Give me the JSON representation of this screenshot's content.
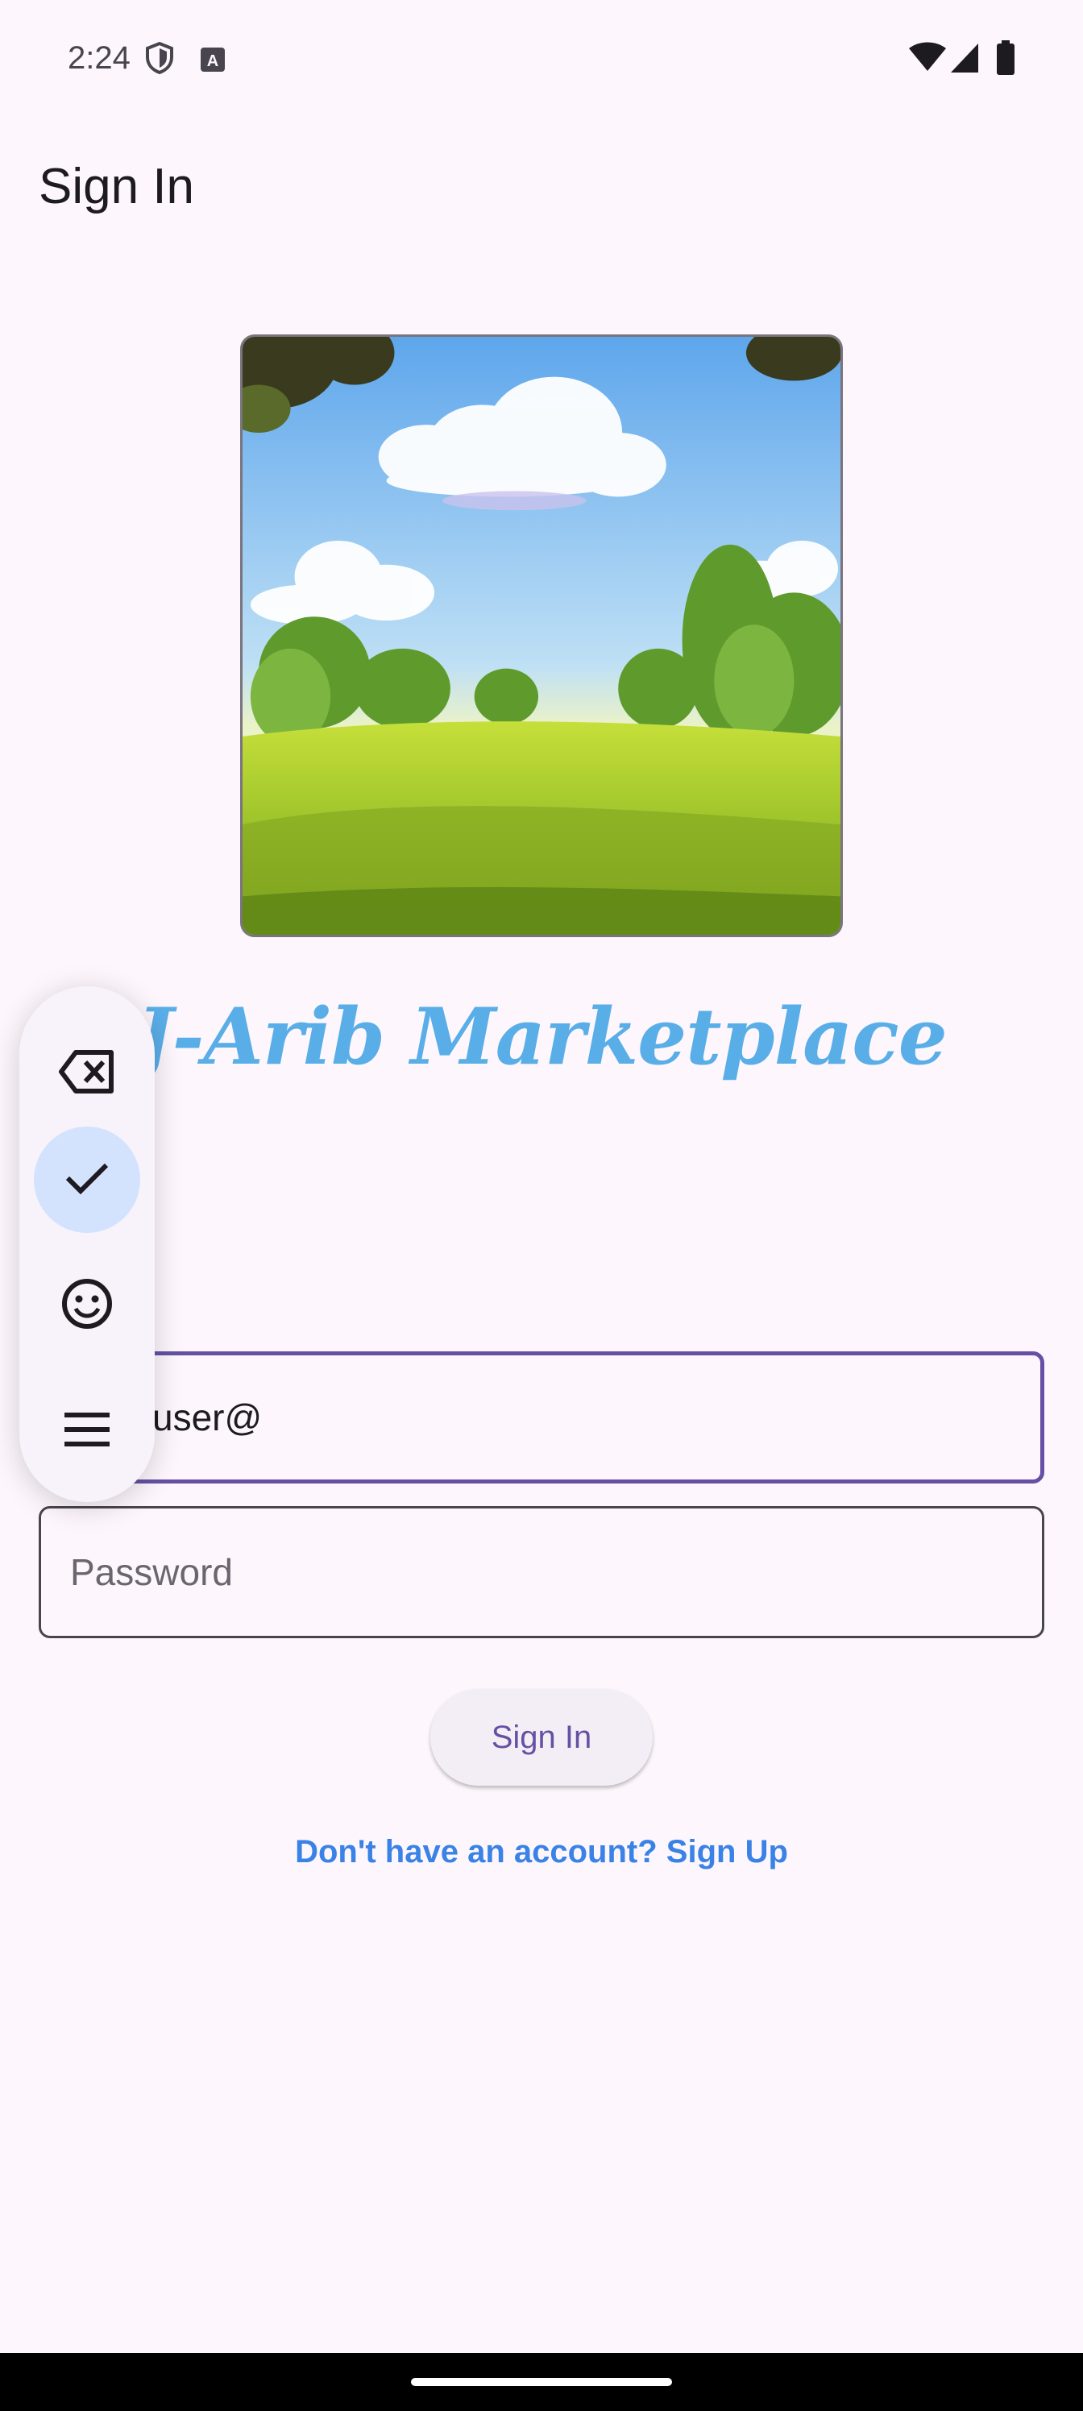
{
  "status_bar": {
    "time": "2:24",
    "icons": [
      "shield-icon",
      "keyboard-a-icon",
      "wifi-icon",
      "signal-icon",
      "battery-icon"
    ]
  },
  "app_bar": {
    "title": "Sign In"
  },
  "hero": {
    "brand_text": "J-Arib Marketplace"
  },
  "form": {
    "email_value": "user@",
    "password_placeholder": "Password",
    "signin_label": "Sign In",
    "signup_link": "Don't have an account? Sign Up"
  },
  "keyboard_toolbar": {
    "buttons": [
      "backspace-icon",
      "check-icon",
      "emoji-icon",
      "menu-icon"
    ]
  },
  "colors": {
    "background": "#fdf7fd",
    "accent": "#6750a4",
    "link": "#3b82e6",
    "brand": "#5aaee8"
  }
}
